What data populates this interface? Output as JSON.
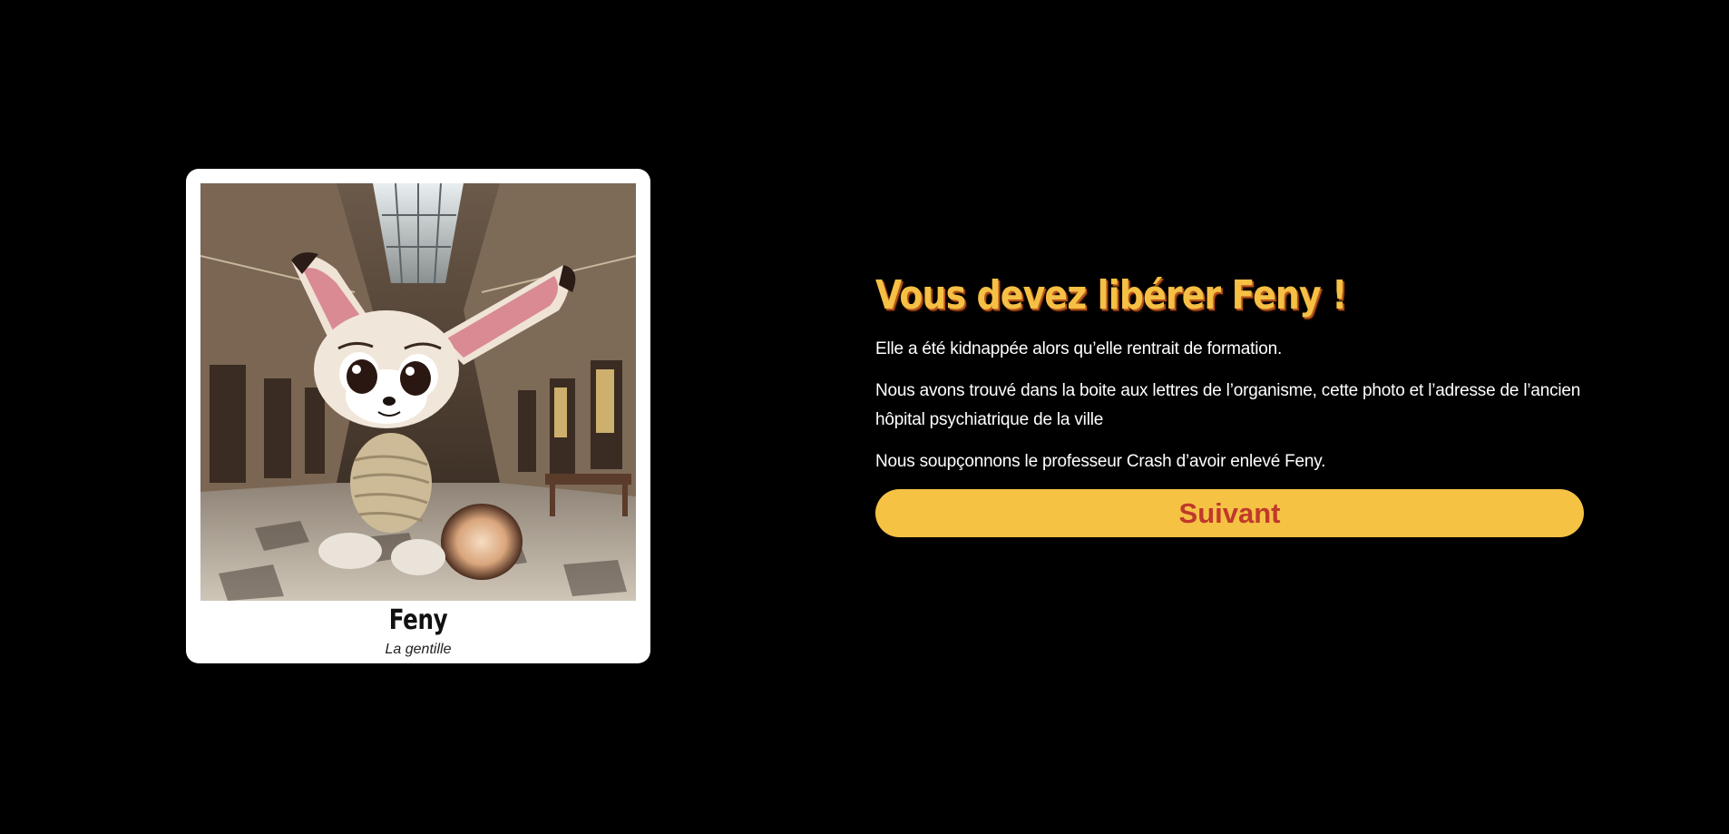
{
  "card": {
    "name": "Feny",
    "subtitle": "La gentille",
    "image_alt": "Feny the fennec fox character tied up in an abandoned hospital hall"
  },
  "content": {
    "headline": "Vous devez libérer Feny !",
    "paragraphs": [
      "Elle a été kidnappée alors qu’elle rentrait de formation.",
      "Nous avons trouvé dans la boite aux lettres de l’organisme, cette photo et l’adresse de l’ancien hôpital psychiatrique de la ville",
      "Nous soupçonnons le professeur Crash d’avoir enlevé Feny."
    ],
    "next_label": "Suivant"
  },
  "colors": {
    "background": "#000000",
    "accent": "#f5c244",
    "button_text": "#c0392b",
    "headline": "#f5c044"
  }
}
